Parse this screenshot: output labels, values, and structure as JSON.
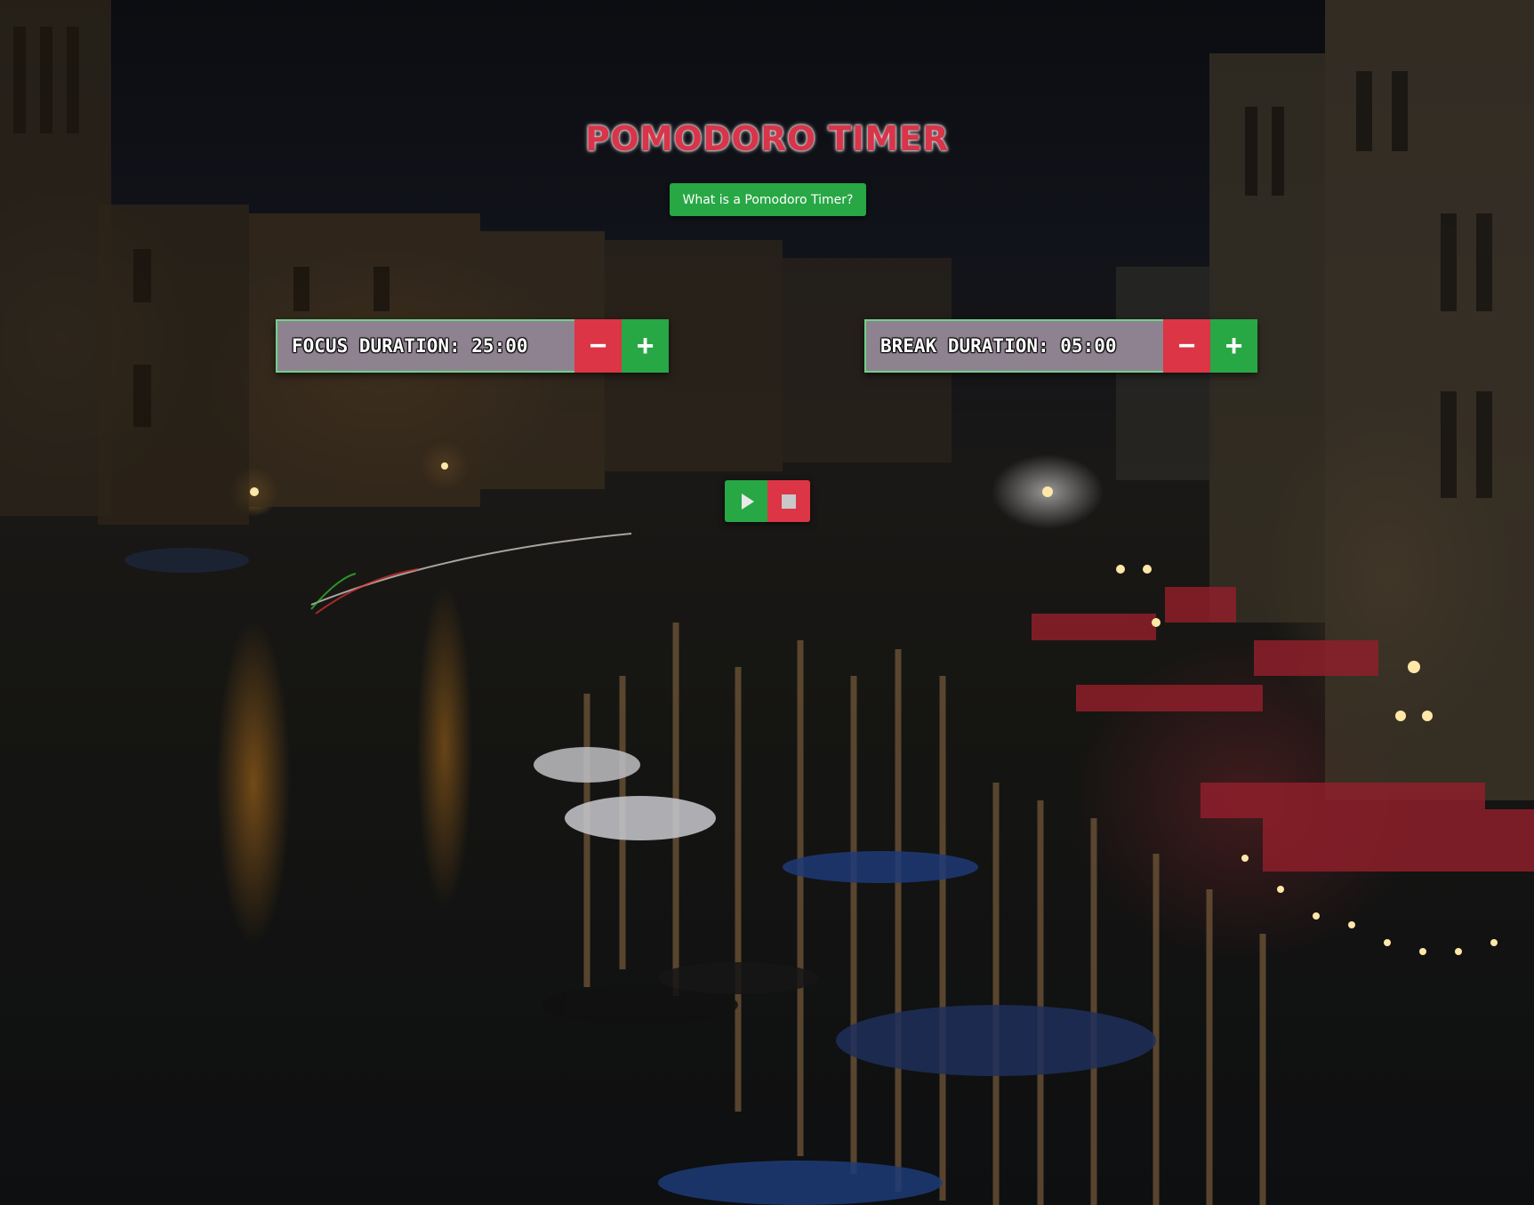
{
  "header": {
    "title": "POMODORO TIMER",
    "info_button_label": "What is a Pomodoro Timer?"
  },
  "focus": {
    "label": "FOCUS DURATION: 25:00",
    "decrement_symbol": "−",
    "increment_symbol": "+"
  },
  "break": {
    "label": "BREAK DURATION: 05:00",
    "decrement_symbol": "−",
    "increment_symbol": "+"
  },
  "controls": {
    "play_icon": "play-icon",
    "stop_icon": "stop-icon"
  },
  "colors": {
    "title_red": "#d8344a",
    "green": "#28a745",
    "red": "#dc3545",
    "panel": "#8f8290",
    "panel_border": "#6fd18a"
  }
}
